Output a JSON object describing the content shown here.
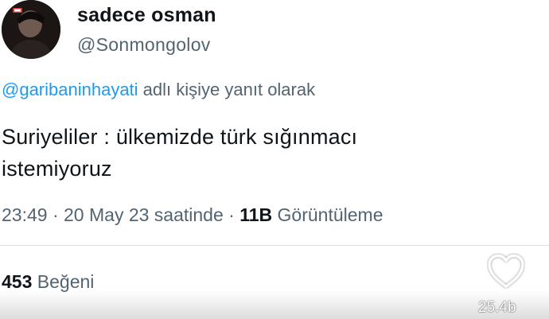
{
  "user": {
    "display_name": "sadece osman",
    "handle": "@Sonmongolov",
    "avatar_icon": "profile-photo"
  },
  "reply": {
    "mention": "@garibaninhayati",
    "suffix": " adlı kişiye yanıt olarak"
  },
  "tweet": {
    "line1": "Suriyeliler : ülkemizde türk sığınmacı",
    "line2": "istemiyoruz"
  },
  "meta": {
    "time": "23:49",
    "separator1": " · ",
    "date": "20 May 23 saatinde",
    "separator2": " · ",
    "views_count": "11B",
    "views_label": " Görüntüleme"
  },
  "stats": {
    "likes_count": "453",
    "likes_label": " Beğeni"
  },
  "overlay": {
    "heart_icon": "heart-outline-icon",
    "count": "25.4b"
  },
  "colors": {
    "text_primary": "#0f1419",
    "text_secondary": "#536471",
    "accent": "#1d9bf0",
    "divider": "#d9dfe3"
  }
}
